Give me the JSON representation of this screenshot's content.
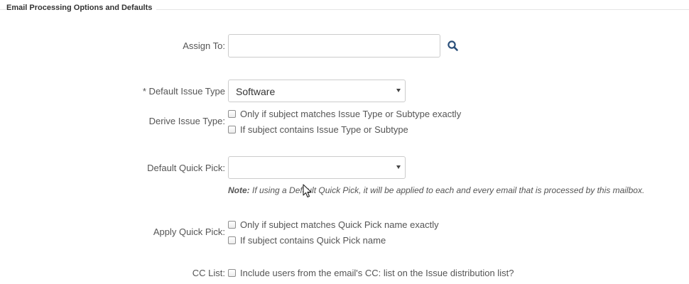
{
  "section": {
    "legend": "Email Processing Options and Defaults"
  },
  "assign_to": {
    "label": "Assign To:",
    "value": "",
    "placeholder": "",
    "search_icon": "search-icon"
  },
  "default_issue_type": {
    "label": "* Default Issue Type",
    "selected": "Software"
  },
  "derive_issue_type": {
    "label": "Derive Issue Type:",
    "options": [
      {
        "label": "Only if subject matches Issue Type or Subtype exactly",
        "checked": false
      },
      {
        "label": "If subject contains Issue Type or Subtype",
        "checked": false
      }
    ]
  },
  "default_quick_pick": {
    "label": "Default Quick Pick:",
    "selected": "",
    "note_prefix": "Note:",
    "note_text": " If using a Default Quick Pick, it will be applied to each and every email that is processed by this mailbox."
  },
  "apply_quick_pick": {
    "label": "Apply Quick Pick:",
    "options": [
      {
        "label": "Only if subject matches Quick Pick name exactly",
        "checked": false
      },
      {
        "label": "If subject contains Quick Pick name",
        "checked": false
      }
    ]
  },
  "cc_list": {
    "label": "CC List:",
    "option": {
      "label": "Include users from the email's CC: list on the Issue distribution list?",
      "checked": false
    }
  },
  "colors": {
    "text": "#555555",
    "border": "#cccccc",
    "icon": "#2a5d8f"
  }
}
